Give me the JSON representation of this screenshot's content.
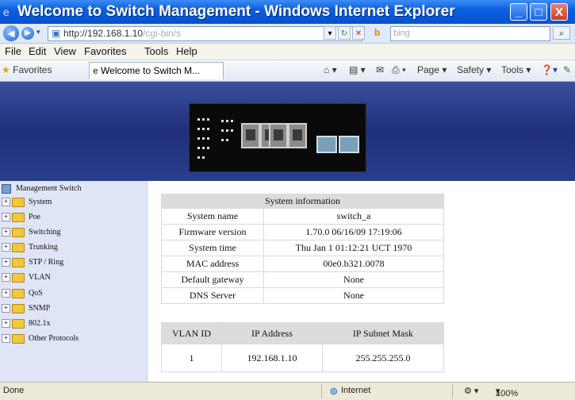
{
  "window": {
    "title": "Welcome to Switch Management - Windows Internet Explorer",
    "minimize": "_",
    "maximize": "□",
    "close": "X"
  },
  "addressbar": {
    "url_main": "http://192.168.1.10",
    "url_rest": "/cgi-bin/s",
    "search_placeholder": "bing"
  },
  "menu": [
    "File",
    "Edit",
    "View",
    "Favorites",
    "Tools",
    "Help"
  ],
  "favbar": {
    "favorites_label": "Favorites",
    "tab_title": "Welcome to Switch M...",
    "commands": [
      "Page ▾",
      "Safety ▾",
      "Tools ▾"
    ]
  },
  "sidebar": {
    "root": "Management Switch",
    "items": [
      "System",
      "Poe",
      "Switching",
      "Trunking",
      "STP / Ring",
      "VLAN",
      "QoS",
      "SNMP",
      "802.1x",
      "Other Protocols"
    ]
  },
  "system_info": {
    "header": "System information",
    "rows": [
      {
        "label": "System name",
        "value": "switch_a"
      },
      {
        "label": "Firmware version",
        "value": "1.70.0 06/16/09 17:19:06"
      },
      {
        "label": "System time",
        "value": "Thu Jan 1 01:12:21 UCT 1970"
      },
      {
        "label": "MAC address",
        "value": "00e0.b321.0078"
      },
      {
        "label": "Default gateway",
        "value": "None"
      },
      {
        "label": "DNS Server",
        "value": "None"
      }
    ]
  },
  "vlan_table": {
    "columns": [
      "VLAN ID",
      "IP Address",
      "IP Subnet Mask"
    ],
    "rows": [
      [
        "1",
        "192.168.1.10",
        "255.255.255.0"
      ]
    ]
  },
  "status": {
    "left": "Done",
    "zone": "Internet",
    "zoom": "100%"
  },
  "colors": {
    "titlebar": "#0a5fe0",
    "banner": "#1f2f7a",
    "sidebar": "#dfe5f7",
    "table_header": "#dcdcdc"
  }
}
